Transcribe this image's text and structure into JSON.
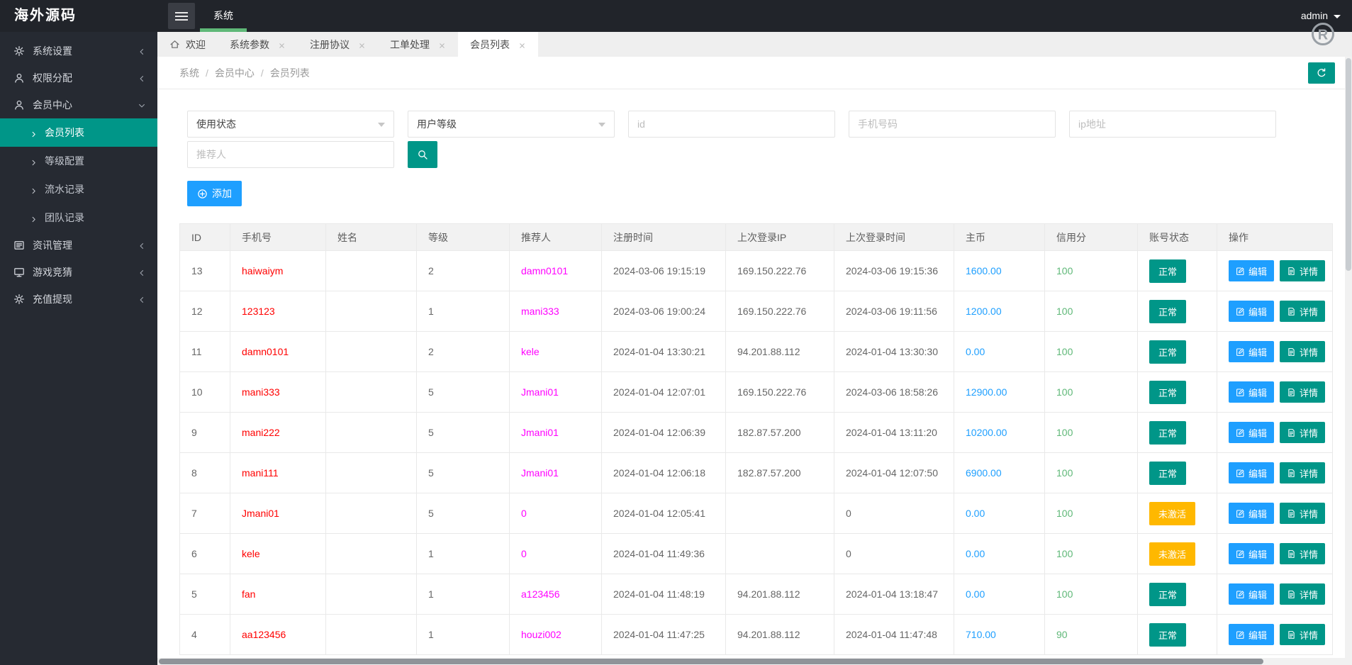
{
  "app": {
    "logo": "海外源码",
    "top_nav": "系统",
    "user": "admin"
  },
  "colors": {
    "teal": "#009688",
    "blue": "#1E9FFF",
    "orange": "#FFB800",
    "green_underline": "#5FB878",
    "red_text": "#FF0000",
    "magenta_text": "#FF00FF",
    "dark_header": "#21242A",
    "dark_sidebar": "#262A32"
  },
  "sidebar": {
    "items": [
      {
        "key": "system-settings",
        "label": "系统设置",
        "icon": "gear",
        "expanded": false
      },
      {
        "key": "permissions",
        "label": "权限分配",
        "icon": "user",
        "expanded": false
      },
      {
        "key": "member-center",
        "label": "会员中心",
        "icon": "user",
        "expanded": true,
        "children": [
          {
            "key": "member-list",
            "label": "会员列表",
            "active": true
          },
          {
            "key": "level-config",
            "label": "等级配置",
            "active": false
          },
          {
            "key": "flow-records",
            "label": "流水记录",
            "active": false
          },
          {
            "key": "team-records",
            "label": "团队记录",
            "active": false
          }
        ]
      },
      {
        "key": "news-manage",
        "label": "资讯管理",
        "icon": "news",
        "expanded": false
      },
      {
        "key": "game-guess",
        "label": "游戏竞猜",
        "icon": "monitor",
        "expanded": false
      },
      {
        "key": "recharge-withdraw",
        "label": "充值提现",
        "icon": "gear",
        "expanded": false
      }
    ]
  },
  "tabs": [
    {
      "key": "welcome",
      "label": "欢迎",
      "icon": "home",
      "closable": false,
      "active": false
    },
    {
      "key": "system-params",
      "label": "系统参数",
      "closable": true,
      "active": false
    },
    {
      "key": "register-agreement",
      "label": "注册协议",
      "closable": true,
      "active": false
    },
    {
      "key": "work-orders",
      "label": "工单处理",
      "closable": true,
      "active": false
    },
    {
      "key": "member-list",
      "label": "会员列表",
      "closable": true,
      "active": true
    }
  ],
  "breadcrumb": [
    "系统",
    "会员中心",
    "会员列表"
  ],
  "filters": {
    "status": "使用状态",
    "level": "用户等级",
    "id": "id",
    "phone": "手机号码",
    "ip": "ip地址",
    "referrer": "推荐人"
  },
  "toolbar": {
    "add_label": "添加"
  },
  "table": {
    "columns": [
      "ID",
      "手机号",
      "姓名",
      "等级",
      "推荐人",
      "注册时间",
      "上次登录IP",
      "上次登录时间",
      "主币",
      "信用分",
      "账号状态",
      "操作"
    ],
    "actions": {
      "edit": "编辑",
      "detail": "详情"
    },
    "status_labels": {
      "normal": "正常",
      "inactive": "未激活"
    },
    "rows": [
      {
        "id": "13",
        "phone": "haiwaiym",
        "name": "",
        "level": "2",
        "referrer": "damn0101",
        "reg_time": "2024-03-06 19:15:19",
        "last_ip": "169.150.222.76",
        "last_time": "2024-03-06 19:15:36",
        "coin": "1600.00",
        "credit": "100",
        "status": "normal"
      },
      {
        "id": "12",
        "phone": "123123",
        "name": "",
        "level": "1",
        "referrer": "mani333",
        "reg_time": "2024-03-06 19:00:24",
        "last_ip": "169.150.222.76",
        "last_time": "2024-03-06 19:11:56",
        "coin": "1200.00",
        "credit": "100",
        "status": "normal"
      },
      {
        "id": "11",
        "phone": "damn0101",
        "name": "",
        "level": "2",
        "referrer": "kele",
        "reg_time": "2024-01-04 13:30:21",
        "last_ip": "94.201.88.112",
        "last_time": "2024-01-04 13:30:30",
        "coin": "0.00",
        "credit": "100",
        "status": "normal"
      },
      {
        "id": "10",
        "phone": "mani333",
        "name": "",
        "level": "5",
        "referrer": "Jmani01",
        "reg_time": "2024-01-04 12:07:01",
        "last_ip": "169.150.222.76",
        "last_time": "2024-03-06 18:58:26",
        "coin": "12900.00",
        "credit": "100",
        "status": "normal"
      },
      {
        "id": "9",
        "phone": "mani222",
        "name": "",
        "level": "5",
        "referrer": "Jmani01",
        "reg_time": "2024-01-04 12:06:39",
        "last_ip": "182.87.57.200",
        "last_time": "2024-01-04 13:11:20",
        "coin": "10200.00",
        "credit": "100",
        "status": "normal"
      },
      {
        "id": "8",
        "phone": "mani111",
        "name": "",
        "level": "5",
        "referrer": "Jmani01",
        "reg_time": "2024-01-04 12:06:18",
        "last_ip": "182.87.57.200",
        "last_time": "2024-01-04 12:07:50",
        "coin": "6900.00",
        "credit": "100",
        "status": "normal"
      },
      {
        "id": "7",
        "phone": "Jmani01",
        "name": "",
        "level": "5",
        "referrer": "0",
        "reg_time": "2024-01-04 12:05:41",
        "last_ip": "",
        "last_time": "0",
        "coin": "0.00",
        "credit": "100",
        "status": "inactive"
      },
      {
        "id": "6",
        "phone": "kele",
        "name": "",
        "level": "1",
        "referrer": "0",
        "reg_time": "2024-01-04 11:49:36",
        "last_ip": "",
        "last_time": "0",
        "coin": "0.00",
        "credit": "100",
        "status": "inactive"
      },
      {
        "id": "5",
        "phone": "fan",
        "name": "",
        "level": "1",
        "referrer": "a123456",
        "reg_time": "2024-01-04 11:48:19",
        "last_ip": "94.201.88.112",
        "last_time": "2024-01-04 13:18:47",
        "coin": "0.00",
        "credit": "100",
        "status": "normal"
      },
      {
        "id": "4",
        "phone": "aa123456",
        "name": "",
        "level": "1",
        "referrer": "houzi002",
        "reg_time": "2024-01-04 11:47:25",
        "last_ip": "94.201.88.112",
        "last_time": "2024-01-04 11:47:48",
        "coin": "710.00",
        "credit": "90",
        "status": "normal"
      }
    ]
  }
}
